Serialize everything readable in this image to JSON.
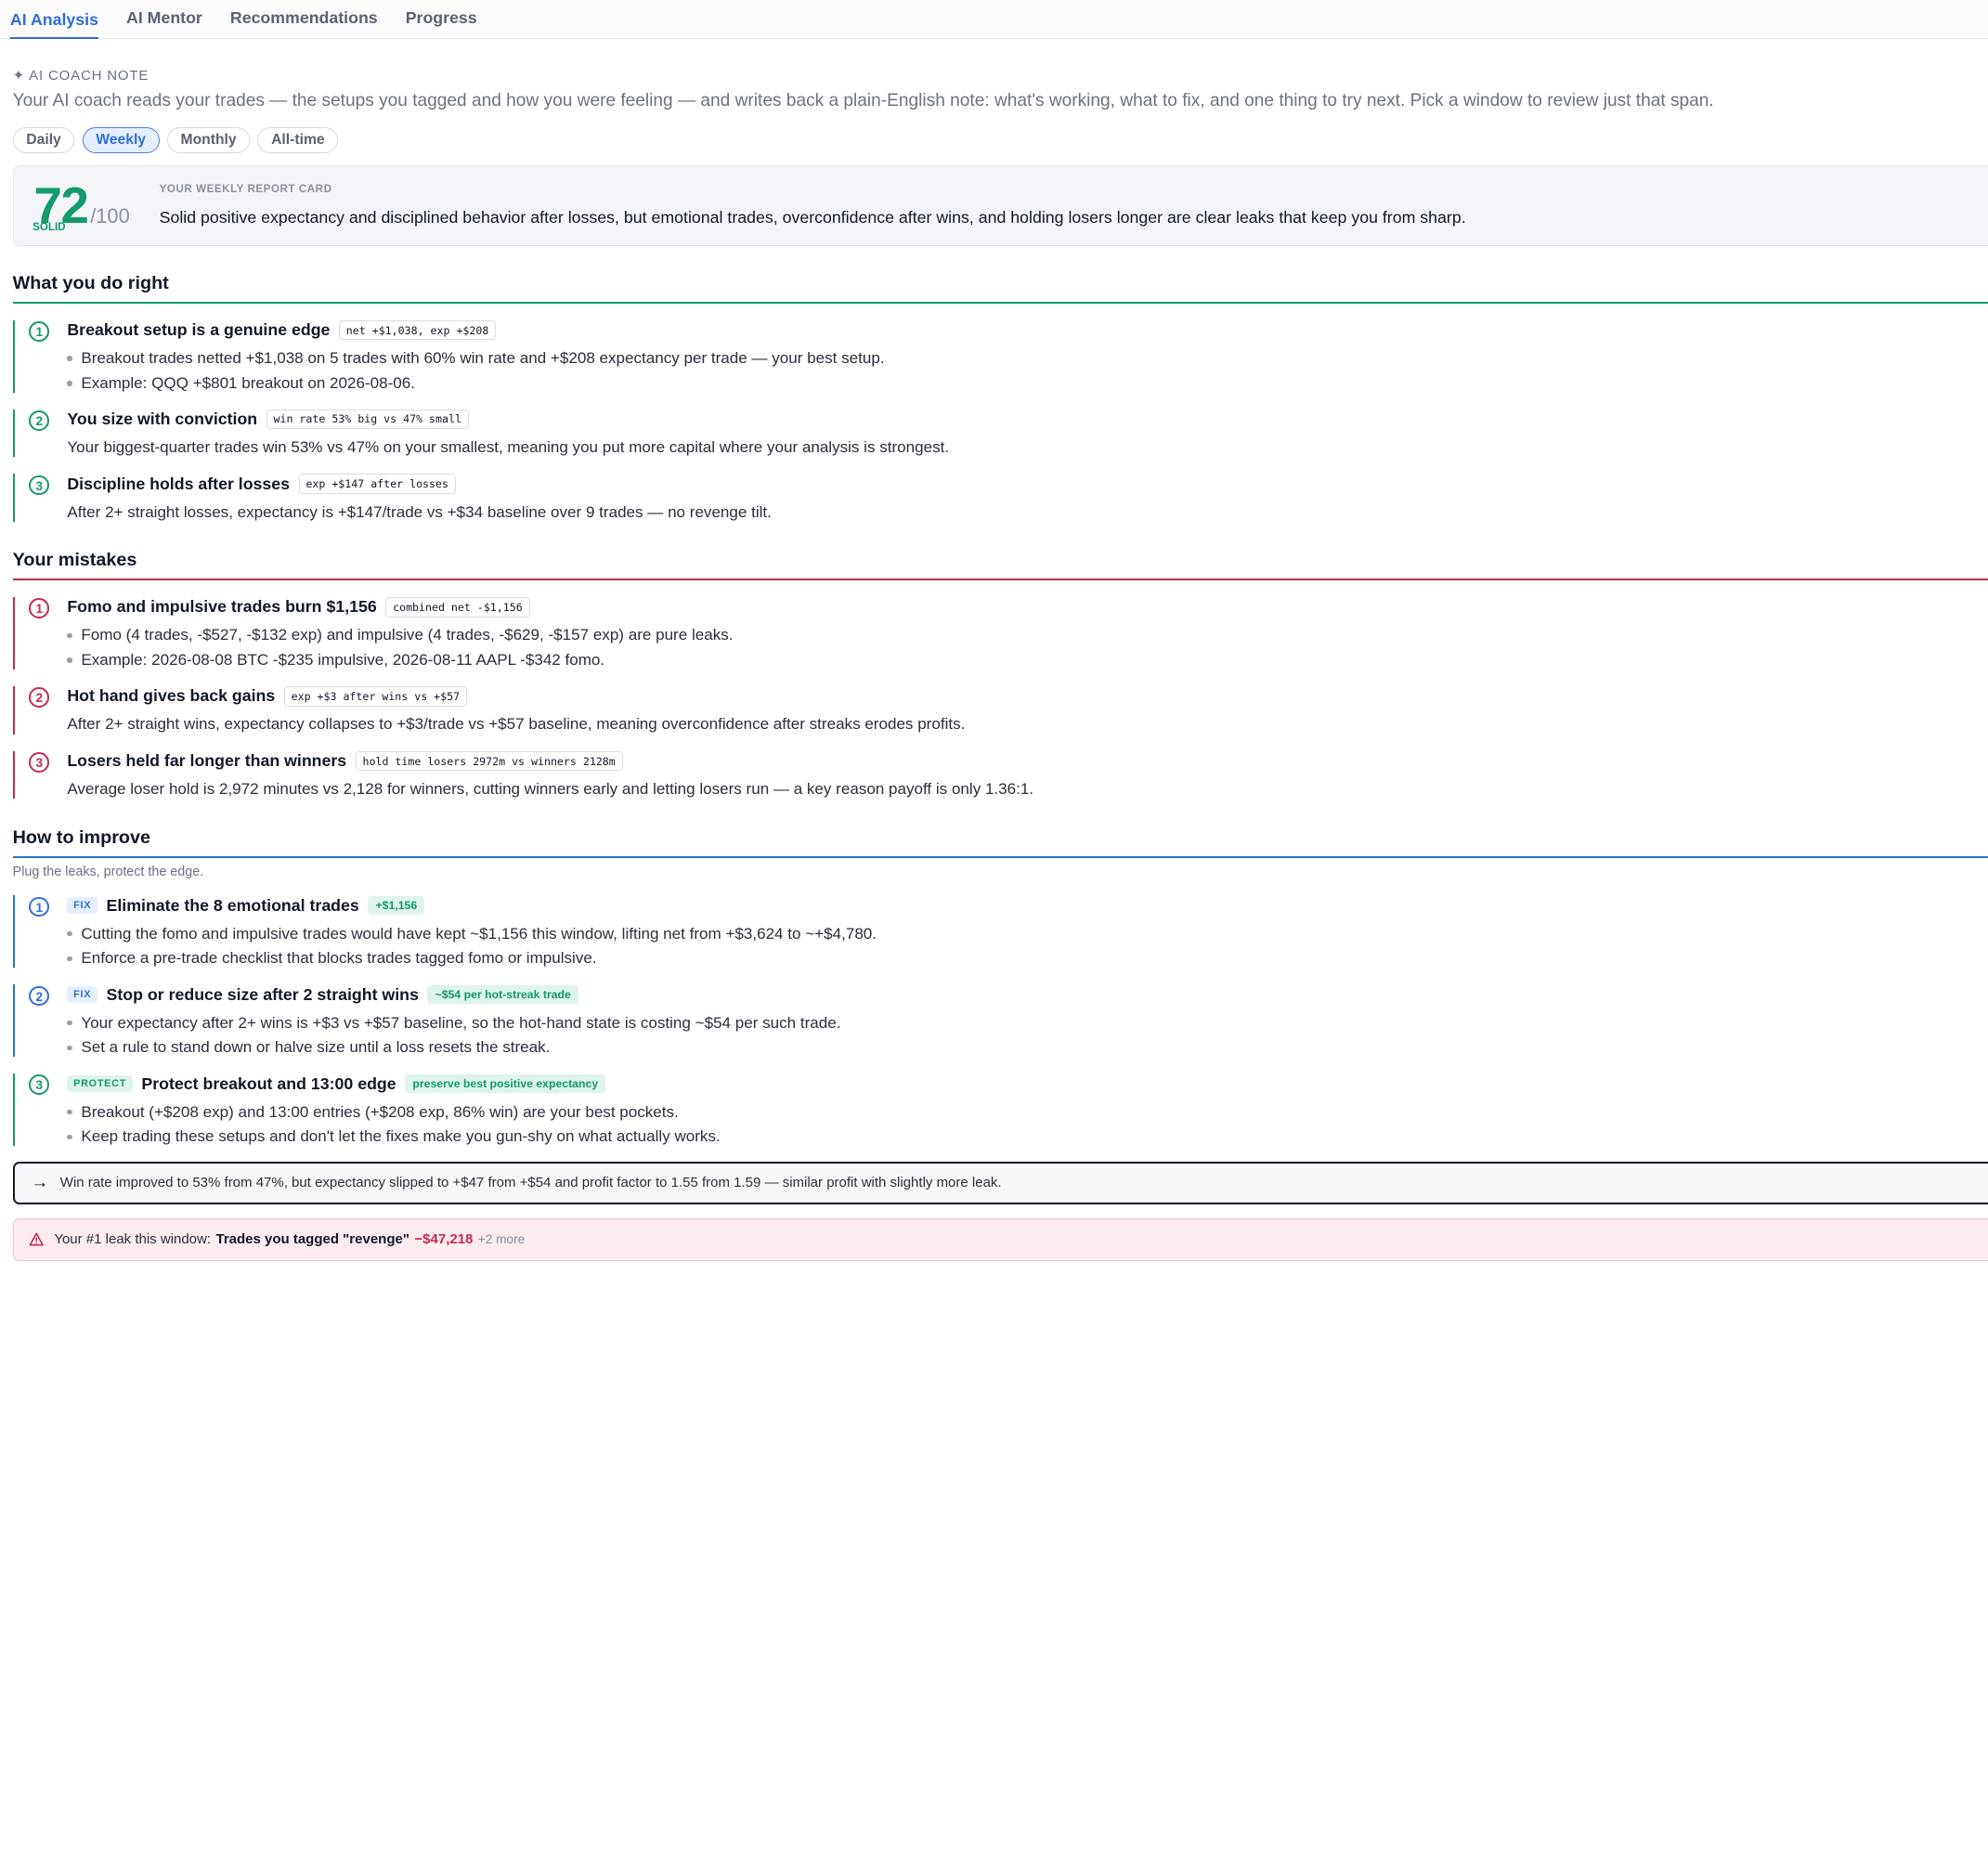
{
  "tabs": [
    {
      "label": "AI Analysis"
    },
    {
      "label": "AI Mentor"
    },
    {
      "label": "Recommendations"
    },
    {
      "label": "Progress"
    }
  ],
  "coach": {
    "label": "✦ AI COACH NOTE",
    "description": "Your AI coach reads your trades — the setups you tagged and how you were feeling — and writes back a plain-English note: what's working, what to fix, and one thing to try next. Pick a window to review just that span."
  },
  "windows": [
    {
      "label": "Daily"
    },
    {
      "label": "Weekly"
    },
    {
      "label": "Monthly"
    },
    {
      "label": "All-time"
    }
  ],
  "report": {
    "score": "72",
    "max": "/100",
    "grade": "SOLID",
    "title": "YOUR WEEKLY REPORT CARD",
    "summary": "Solid positive expectancy and disciplined behavior after losses, but emotional trades, overconfidence after wins, and holding losers longer are clear leaks that keep you from sharp."
  },
  "right": {
    "heading": "What you do right",
    "items": [
      {
        "num": "1",
        "title": "Breakout setup is a genuine edge",
        "badge": "net +$1,038, exp +$208",
        "lines": [
          "Breakout trades netted +$1,038 on 5 trades with 60% win rate and +$208 expectancy per trade — your best setup.",
          "Example: QQQ +$801 breakout on 2026-08-06."
        ]
      },
      {
        "num": "2",
        "title": "You size with conviction",
        "badge": "win rate 53% big vs 47% small",
        "lines": [
          "Your biggest-quarter trades win 53% vs 47% on your smallest, meaning you put more capital where your analysis is strongest."
        ]
      },
      {
        "num": "3",
        "title": "Discipline holds after losses",
        "badge": "exp +$147 after losses",
        "lines": [
          "After 2+ straight losses, expectancy is +$147/trade vs +$34 baseline over 9 trades — no revenge tilt."
        ]
      }
    ]
  },
  "mistakes": {
    "heading": "Your mistakes",
    "items": [
      {
        "num": "1",
        "title": "Fomo and impulsive trades burn $1,156",
        "badge": "combined net -$1,156",
        "lines": [
          "Fomo (4 trades, -$527, -$132 exp) and impulsive (4 trades, -$629, -$157 exp) are pure leaks.",
          "Example: 2026-08-08 BTC -$235 impulsive, 2026-08-11 AAPL -$342 fomo."
        ]
      },
      {
        "num": "2",
        "title": "Hot hand gives back gains",
        "badge": "exp +$3 after wins vs +$57",
        "lines": [
          "After 2+ straight wins, expectancy collapses to +$3/trade vs +$57 baseline, meaning overconfidence after streaks erodes profits."
        ]
      },
      {
        "num": "3",
        "title": "Losers held far longer than winners",
        "badge": "hold time losers 2972m vs winners 2128m",
        "lines": [
          "Average loser hold is 2,972 minutes vs 2,128 for winners, cutting winners early and letting losers run — a key reason payoff is only 1.36:1."
        ]
      }
    ]
  },
  "improve": {
    "heading": "How to improve",
    "subheading": "Plug the leaks, protect the edge.",
    "items": [
      {
        "num": "1",
        "kind": "FIX",
        "title": "Eliminate the 8 emotional trades",
        "gain": "+$1,156",
        "lines": [
          "Cutting the fomo and impulsive trades would have kept ~$1,156 this window, lifting net from +$3,624 to ~+$4,780.",
          "Enforce a pre-trade checklist that blocks trades tagged fomo or impulsive."
        ]
      },
      {
        "num": "2",
        "kind": "FIX",
        "title": "Stop or reduce size after 2 straight wins",
        "gain": "~$54 per hot-streak trade",
        "lines": [
          "Your expectancy after 2+ wins is +$3 vs +$57 baseline, so the hot-hand state is costing ~$54 per such trade.",
          "Set a rule to stand down or halve size until a loss resets the streak."
        ]
      },
      {
        "num": "3",
        "kind": "PROTECT",
        "title": "Protect breakout and 13:00 edge",
        "gain": "preserve best positive expectancy",
        "lines": [
          "Breakout (+$208 exp) and 13:00 entries (+$208 exp, 86% win) are your best pockets.",
          "Keep trading these setups and don't let the fixes make you gun-shy on what actually works."
        ]
      }
    ]
  },
  "trend": {
    "arrow": "→",
    "text": "Win rate improved to 53% from 47%, but expectancy slipped to +$47 from +$54 and profit factor to 1.55 from 1.59 — similar profit with slightly more leak."
  },
  "leak": {
    "prefix": "Your #1 leak this window:",
    "name": "Trades you tagged \"revenge\"",
    "amount": "−$47,218",
    "more": "+2 more"
  }
}
